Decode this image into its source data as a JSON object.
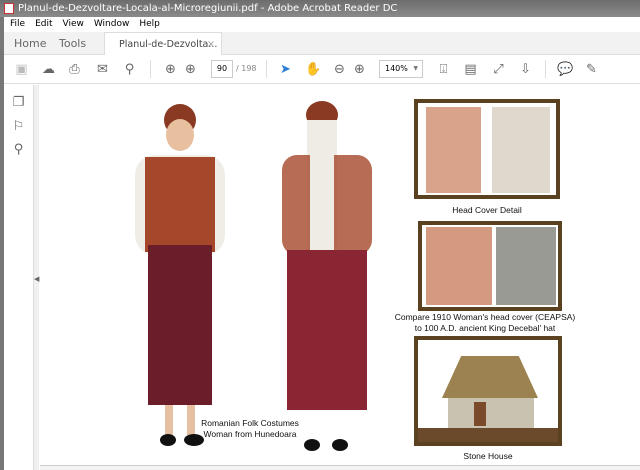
{
  "window": {
    "title": "Planul-de-Dezvoltare-Locala-al-Microregiunii.pdf - Adobe Acrobat Reader DC"
  },
  "menu": [
    "File",
    "Edit",
    "View",
    "Window",
    "Help"
  ],
  "tabs": {
    "home": "Home",
    "tools": "Tools",
    "document": "Planul-de-Dezvolta...",
    "close": "×"
  },
  "toolbar": {
    "page_current": "90",
    "page_total": "/ 198",
    "zoom": "140%"
  },
  "page": {
    "caption_main": [
      "Romanian Folk Costumes",
      "Woman from Hunedoara"
    ],
    "caption_head": "Head Cover Detail",
    "caption_compare": [
      "Compare 1910 Woman's head cover (CEAPSA)",
      "to 100 A.D.  ancient King Decebal' hat"
    ],
    "caption_house": "Stone House"
  },
  "colors": {
    "frame": "#5a4220",
    "accent": "#2d7fd3"
  }
}
